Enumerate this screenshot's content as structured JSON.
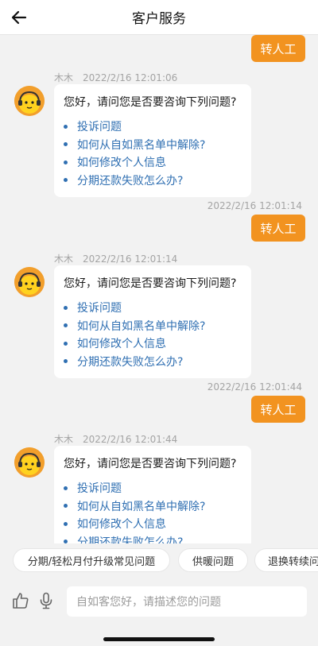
{
  "header": {
    "title": "客户服务"
  },
  "transfer_label": "转人工",
  "bot_name": "木木",
  "user_times": [
    "2022/2/16 12:01:14",
    "2022/2/16 12:01:44"
  ],
  "messages": [
    {
      "time": "2022/2/16 12:01:06",
      "question": "您好，请问您是否要咨询下列问题?",
      "options": [
        "投诉问题",
        "如何从自如黑名单中解除?",
        "如何修改个人信息",
        "分期还款失败怎么办?"
      ]
    },
    {
      "time": "2022/2/16 12:01:14",
      "question": "您好，请问您是否要咨询下列问题?",
      "options": [
        "投诉问题",
        "如何从自如黑名单中解除?",
        "如何修改个人信息",
        "分期还款失败怎么办?"
      ]
    },
    {
      "time": "2022/2/16 12:01:44",
      "question": "您好，请问您是否要咨询下列问题?",
      "options": [
        "投诉问题",
        "如何从自如黑名单中解除?",
        "如何修改个人信息",
        "分期还款失败怎么办?"
      ]
    }
  ],
  "quick_chips": [
    "分期/轻松月付升级常见问题",
    "供暖问题",
    "退换转续问"
  ],
  "input": {
    "placeholder": "自如客您好，请描述您的问题"
  },
  "colors": {
    "accent": "#f29320",
    "link": "#2f6fb2",
    "background": "#f2f2f2"
  },
  "icons": [
    "back-arrow-icon",
    "bot-avatar-icon",
    "thumbs-up-icon",
    "microphone-icon"
  ]
}
